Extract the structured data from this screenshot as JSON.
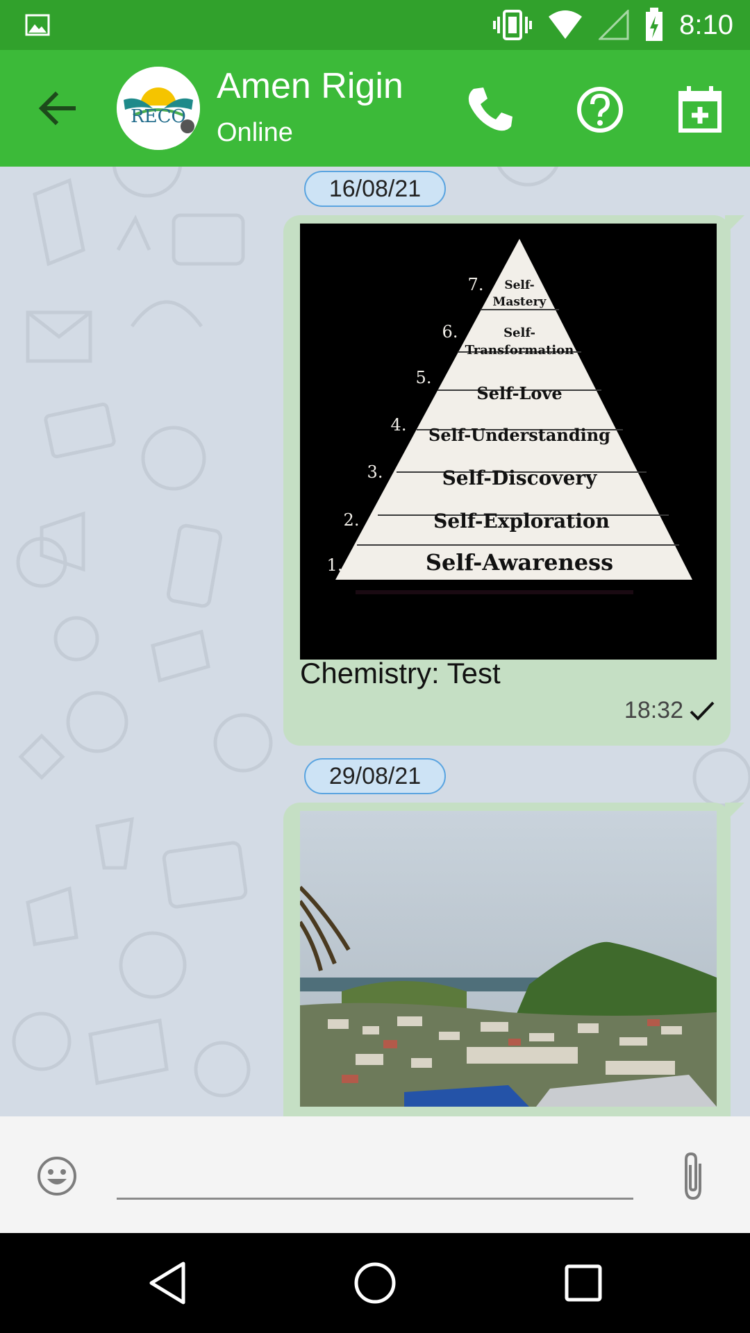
{
  "status_bar": {
    "time": "8:10",
    "icons": [
      "image-icon",
      "vibrate-icon",
      "wifi-icon",
      "signal-icon",
      "battery-icon"
    ]
  },
  "header": {
    "contact_name": "Amen Rigin",
    "contact_status": "Online",
    "avatar_logo_text": "RECO",
    "icons": [
      "back-arrow-icon",
      "phone-icon",
      "help-icon",
      "calendar-add-icon"
    ],
    "accent_color": "#3cba39",
    "status_bar_color": "#31a12c"
  },
  "messages": [
    {
      "date": "16/08/21",
      "image_alt": "Self pyramid",
      "pyramid_levels": [
        {
          "number": "7.",
          "label": "Self-\nMastery"
        },
        {
          "number": "6.",
          "label": "Self-\nTransformation"
        },
        {
          "number": "5.",
          "label": "Self-Love"
        },
        {
          "number": "4.",
          "label": "Self-Understanding"
        },
        {
          "number": "3.",
          "label": "Self-Discovery"
        },
        {
          "number": "2.",
          "label": "Self-Exploration"
        },
        {
          "number": "1.",
          "label": "Self-Awareness"
        }
      ],
      "caption": "Chemistry: Test",
      "time": "18:32",
      "status_icon": "check-icon"
    },
    {
      "date": "29/08/21",
      "image_alt": "Hillside town landscape"
    }
  ],
  "composer": {
    "placeholder": "",
    "icons": [
      "emoji-icon",
      "attach-icon"
    ]
  },
  "nav_bar": {
    "icons": [
      "back-nav-icon",
      "home-nav-icon",
      "recents-nav-icon"
    ]
  }
}
